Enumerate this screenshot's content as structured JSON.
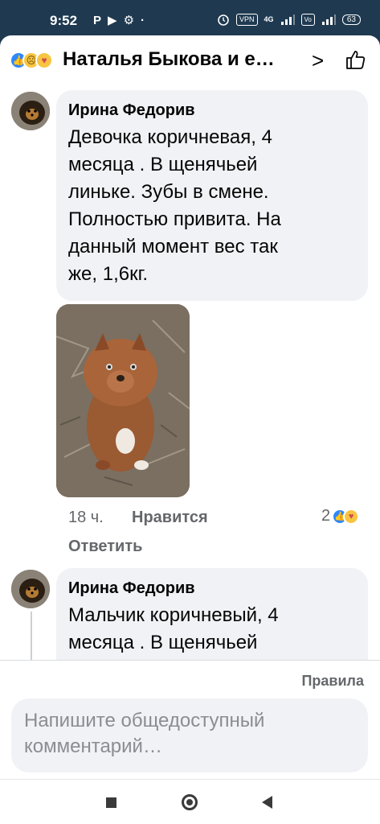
{
  "status_bar": {
    "time": "9:52",
    "left_icons": [
      "P",
      "▶",
      "⚙",
      "·"
    ],
    "right_icons": [
      "alarm-icon",
      "vpn-icon",
      "signal-icon",
      "volte-icon",
      "battery-icon"
    ],
    "vpn": "VPN",
    "network": "4G",
    "battery": "63"
  },
  "header": {
    "title": "Наталья Быкова и е…",
    "reactions": [
      "like",
      "sad",
      "care"
    ]
  },
  "comments": [
    {
      "author": "Ирина Федорив",
      "text_lines": [
        "Девочка коричневая, 4",
        "месяца . В щенячьей",
        "линьке. Зубы в смене.",
        "Полностью привита. На",
        "данный момент вес так",
        "же, 1,6кг."
      ],
      "time": "18 ч.",
      "like_label": "Нравится",
      "reply_label": "Ответить",
      "reaction_count": "2"
    },
    {
      "author": "Ирина Федорив",
      "text_lines": [
        "Мальчик коричневый, 4",
        "месяца . В щенячьей"
      ]
    }
  ],
  "footer": {
    "rules_label": "Правила",
    "input_placeholder": "Напишите общедоступный комментарий…"
  },
  "colors": {
    "status_bar": "#1f3a50",
    "bubble": "#f0f2f5",
    "like_blue": "#2d88ff",
    "meta_gray": "#65676b"
  }
}
